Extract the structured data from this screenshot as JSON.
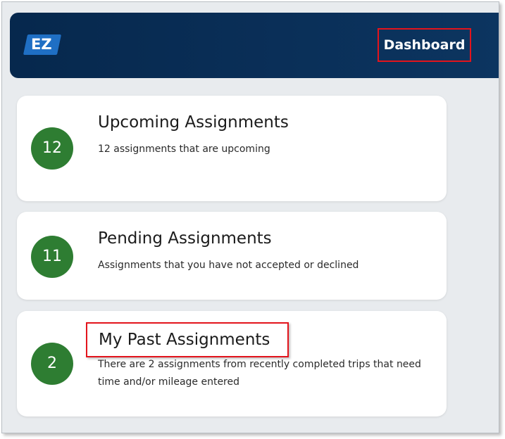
{
  "header": {
    "logo_text": "EZ",
    "nav_label": "Dashboard"
  },
  "cards": [
    {
      "count": "12",
      "title": "Upcoming Assignments",
      "description": "12 assignments that are upcoming"
    },
    {
      "count": "11",
      "title": "Pending Assignments",
      "description": "Assignments that you have not accepted or declined"
    },
    {
      "count": "2",
      "title": "My Past Assignments",
      "description": "There are 2 assignments from recently completed trips that need time and/or mileage entered"
    }
  ],
  "colors": {
    "header_bg": "#06284d",
    "logo_bg": "#1f6fc4",
    "badge_bg": "#2e7d32",
    "highlight_border": "#e3141c",
    "page_bg": "#e8ebee"
  }
}
